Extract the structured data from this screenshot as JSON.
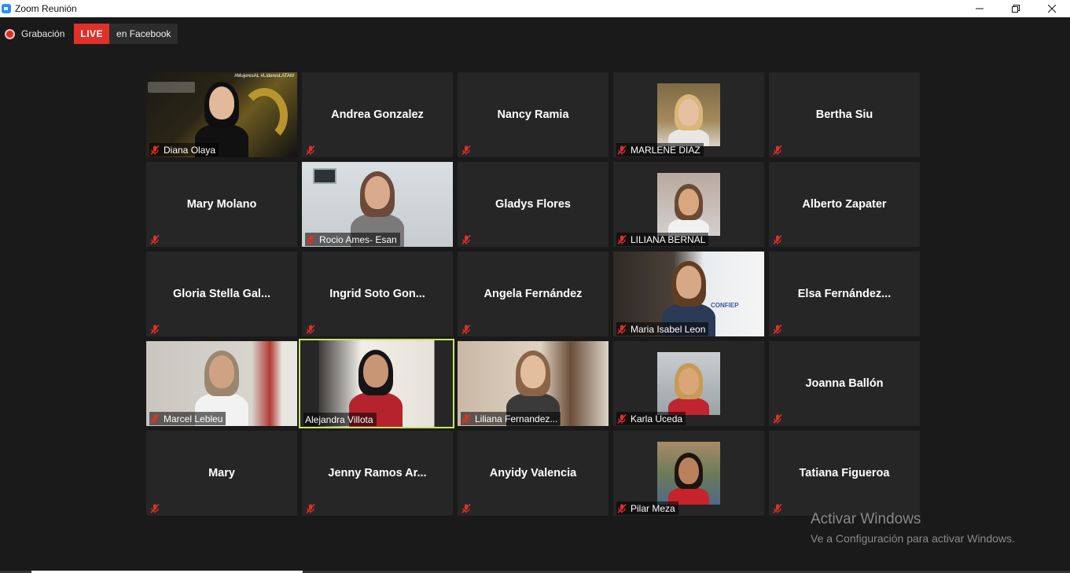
{
  "window": {
    "title": "Zoom Reunión"
  },
  "recording": {
    "label": "Grabación",
    "live": "LIVE",
    "destination": "en Facebook"
  },
  "tiles": [
    {
      "id": "t1",
      "name": "Diana Olaya",
      "video": true,
      "muted": true,
      "banner": "#MujeresAL  #LíderesLATAM"
    },
    {
      "id": "t2",
      "name": "Andrea Gonzalez",
      "video": false,
      "muted": true
    },
    {
      "id": "t3",
      "name": "Nancy Ramia",
      "video": false,
      "muted": true
    },
    {
      "id": "t4",
      "name": "MARLENE DIAZ",
      "video": true,
      "muted": true
    },
    {
      "id": "t5",
      "name": "Bertha Siu",
      "video": false,
      "muted": true
    },
    {
      "id": "t6",
      "name": "Mary Molano",
      "video": false,
      "muted": true
    },
    {
      "id": "t7",
      "name": "Rocio Ames- Esan",
      "video": true,
      "muted": true
    },
    {
      "id": "t8",
      "name": "Gladys Flores",
      "video": false,
      "muted": true
    },
    {
      "id": "t9",
      "name": "LILIANA BERNAL",
      "video": true,
      "muted": true
    },
    {
      "id": "t10",
      "name": "Alberto Zapater",
      "video": false,
      "muted": true
    },
    {
      "id": "t11",
      "name": "Gloria Stella Gal...",
      "video": false,
      "muted": true
    },
    {
      "id": "t12",
      "name": "Ingrid Soto Gon...",
      "video": false,
      "muted": true
    },
    {
      "id": "t13",
      "name": "Angela Fernández",
      "video": false,
      "muted": true
    },
    {
      "id": "t14",
      "name": "Maria Isabel Leon",
      "video": true,
      "muted": true,
      "banner": "CONFIEP"
    },
    {
      "id": "t15",
      "name": "Elsa Fernández...",
      "video": false,
      "muted": true
    },
    {
      "id": "t16",
      "name": "Marcel Lebleu",
      "video": true,
      "muted": true
    },
    {
      "id": "t17",
      "name": "Alejandra Villota",
      "video": true,
      "muted": false,
      "active": true
    },
    {
      "id": "t18",
      "name": "Liliana Fernandez...",
      "video": true,
      "muted": true
    },
    {
      "id": "t19",
      "name": "Karla Uceda",
      "video": true,
      "muted": true
    },
    {
      "id": "t20",
      "name": "Joanna Ballón",
      "video": false,
      "muted": true
    },
    {
      "id": "t21",
      "name": "Mary",
      "video": false,
      "muted": true
    },
    {
      "id": "t22",
      "name": "Jenny Ramos Ar...",
      "video": false,
      "muted": true
    },
    {
      "id": "t23",
      "name": "Anyidy Valencia",
      "video": false,
      "muted": true
    },
    {
      "id": "t24",
      "name": "Pilar Meza",
      "video": true,
      "muted": true
    },
    {
      "id": "t25",
      "name": "Tatiana Figueroa",
      "video": false,
      "muted": true
    }
  ],
  "watermark": {
    "line1": "Activar Windows",
    "line2": "Ve a Configuración para activar Windows."
  },
  "colors": {
    "live": "#e0302a",
    "active_speaker": "#c8e36a",
    "muted_icon": "#e0302a"
  }
}
